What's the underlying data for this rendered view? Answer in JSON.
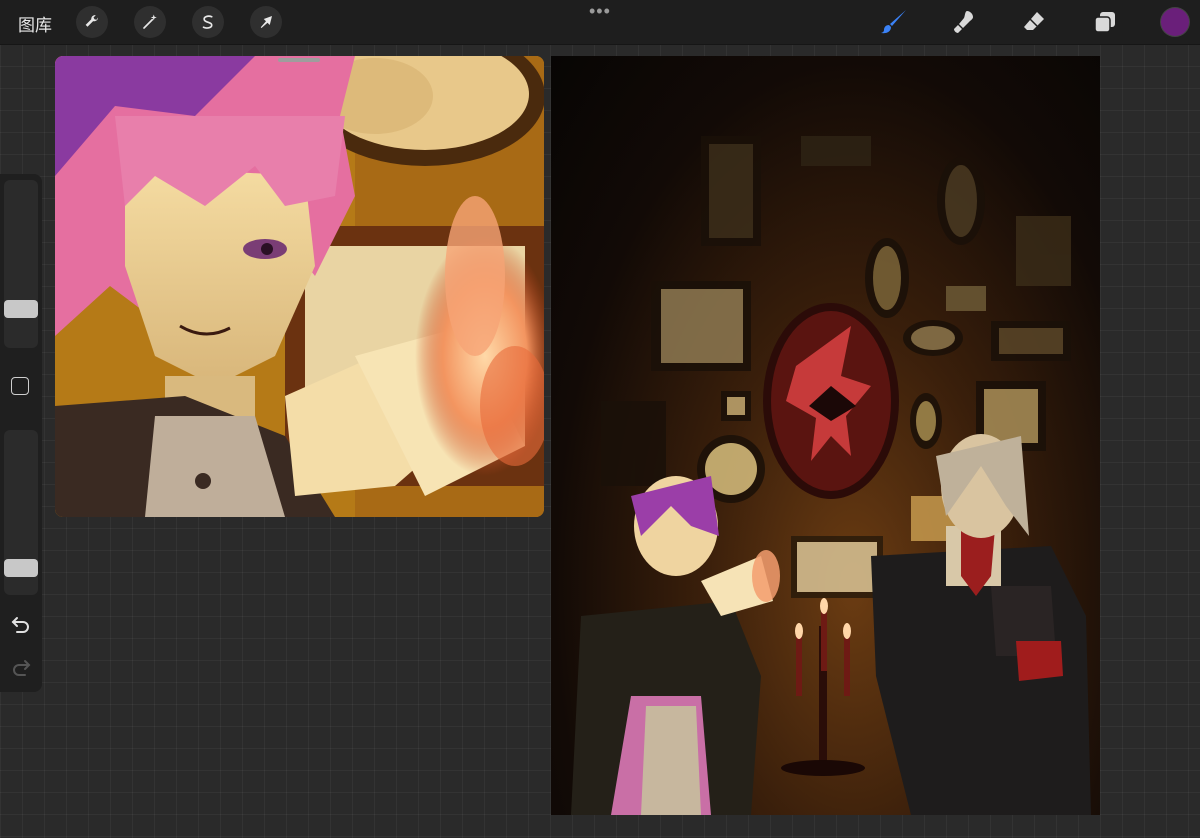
{
  "topbar": {
    "gallery_label": "图库",
    "left_tools": [
      "wrench-icon",
      "magic-wand-icon",
      "selection-icon",
      "transform-arrow-icon"
    ],
    "more_menu": "•••",
    "right_tools": [
      "brush-icon",
      "smudge-icon",
      "eraser-icon",
      "layers-icon"
    ],
    "accent_color": "#3b82f6",
    "current_color": "#6a1f7a"
  },
  "sidebar": {
    "brush_size_level": 0.72,
    "opacity_level": 0.92,
    "controls": [
      "modify-button",
      "undo-icon",
      "redo-icon"
    ]
  },
  "canvases": {
    "left_artwork": "illustration",
    "right_artwork": "illustration"
  }
}
